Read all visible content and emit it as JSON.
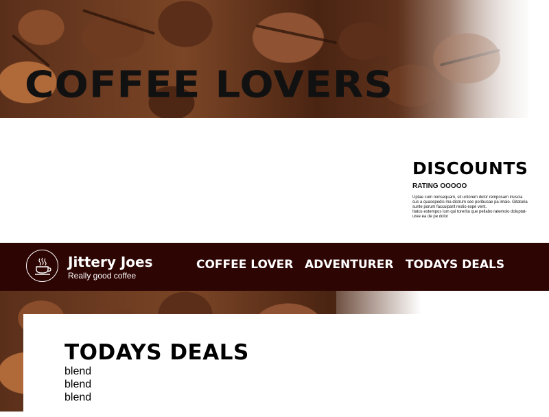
{
  "hero": {
    "title": "COFFEE LOVERS"
  },
  "discounts": {
    "title": "DISCOUNTS",
    "rating": "RATING OOOOO",
    "description_lines": [
      "Uptae cum nonsequam, sit untorem dolor remposam inuscia",
      "cus a quasepedis ma distrum see poribusae pa imaio. Gitaturia",
      "sunte porum faccuiparit restio expe vent.",
      "Itatus estempos ium qui torerita que pellabo ratemolo doluptat-",
      "uree ea de pe dolor"
    ]
  },
  "navbar": {
    "brand_name": "Jittery Joes",
    "brand_tagline": "Really good coffee",
    "logo_icon": "coffee-cup-icon",
    "links": [
      "COFFEE LOVER",
      "ADVENTURER",
      "TODAYS DEALS"
    ]
  },
  "deals": {
    "title": "TODAYS DEALS",
    "items": [
      "blend",
      "blend",
      "blend"
    ]
  },
  "colors": {
    "navbar_bg": "#2d0503",
    "text_dark": "#000000",
    "text_light": "#ffffff",
    "bean_brown": "#6a3a22"
  }
}
